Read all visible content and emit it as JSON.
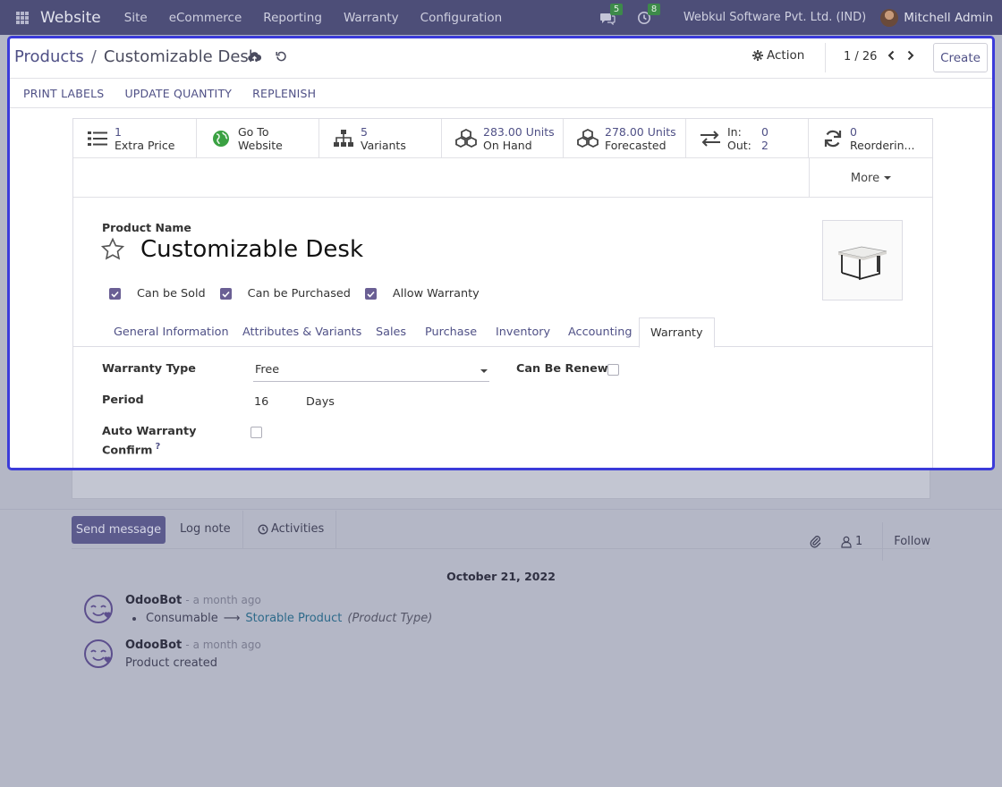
{
  "navbar": {
    "brand": "Website",
    "menu": [
      "Site",
      "eCommerce",
      "Reporting",
      "Warranty",
      "Configuration"
    ],
    "messages_count": "5",
    "activities_count": "8",
    "company": "Webkul Software Pvt. Ltd. (IND)",
    "user": "Mitchell Admin"
  },
  "control_panel": {
    "breadcrumb_parent": "Products",
    "breadcrumb_sep": "/",
    "breadcrumb_current": "Customizable Desk",
    "action_label": "Action",
    "pager": "1 / 26",
    "create_label": "Create"
  },
  "statusbar": {
    "buttons": [
      "PRINT LABELS",
      "UPDATE QUANTITY",
      "REPLENISH"
    ]
  },
  "smart_buttons": {
    "extra_price": {
      "value": "1",
      "label": "Extra Price"
    },
    "website": {
      "line1": "Go To",
      "line2": "Website"
    },
    "variants": {
      "value": "5",
      "label": "Variants"
    },
    "on_hand": {
      "value": "283.00 Units",
      "label": "On Hand"
    },
    "forecasted": {
      "value": "278.00 Units",
      "label": "Forecasted"
    },
    "in_out": {
      "in_label": "In:",
      "in_value": "0",
      "out_label": "Out:",
      "out_value": "2"
    },
    "reordering": {
      "value": "0",
      "label": "Reorderin..."
    },
    "more_label": "More"
  },
  "product": {
    "name_label": "Product Name",
    "name": "Customizable Desk",
    "can_be_sold": "Can be Sold",
    "can_be_purchased": "Can be Purchased",
    "allow_warranty": "Allow Warranty"
  },
  "tabs": [
    "General Information",
    "Attributes & Variants",
    "Sales",
    "Purchase",
    "Inventory",
    "Accounting",
    "Warranty"
  ],
  "warranty": {
    "type_label": "Warranty Type",
    "type_value": "Free",
    "renew_label": "Can Be Renew",
    "period_label": "Period",
    "period_value": "16",
    "period_unit": "Days",
    "auto_confirm_label_1": "Auto Warranty",
    "auto_confirm_label_2": "Confirm",
    "help_mark": "?"
  },
  "chatter": {
    "send_message": "Send message",
    "log_note": "Log note",
    "activities": "Activities",
    "followers_count": "1",
    "follow": "Follow",
    "date": "October 21, 2022",
    "messages": [
      {
        "author": "OdooBot",
        "ago": "- a month ago",
        "old_value": "Consumable",
        "arrow": "⟶",
        "new_value": "Storable Product",
        "field": "(Product Type)"
      },
      {
        "author": "OdooBot",
        "ago": "- a month ago",
        "body": "Product created"
      }
    ]
  }
}
